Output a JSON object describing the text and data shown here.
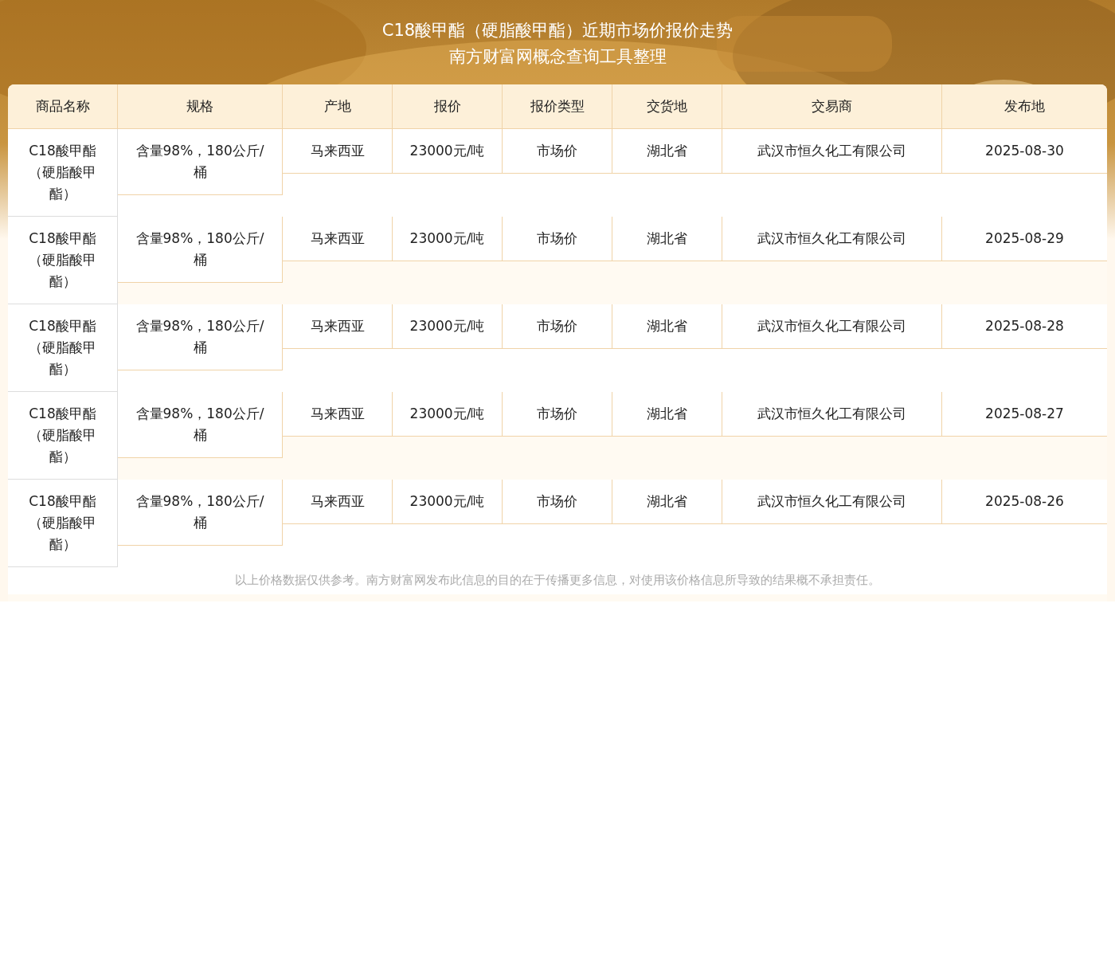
{
  "title": {
    "line_1": "C18酸甲酯（硬脂酸甲酯）近期市场价报价走势",
    "line_2": "南方财富网概念查询工具整理"
  },
  "table": {
    "columns": [
      "商品名称",
      "规格",
      "产地",
      "报价",
      "报价类型",
      "交货地",
      "交易商",
      "发布地"
    ],
    "rows": [
      [
        "C18酸甲酯（硬脂酸甲酯）",
        "含量98%，180公斤/桶",
        "马来西亚",
        "23000元/吨",
        "市场价",
        "湖北省",
        "武汉市恒久化工有限公司",
        "2025-08-30"
      ],
      [
        "C18酸甲酯（硬脂酸甲酯）",
        "含量98%，180公斤/桶",
        "马来西亚",
        "23000元/吨",
        "市场价",
        "湖北省",
        "武汉市恒久化工有限公司",
        "2025-08-29"
      ],
      [
        "C18酸甲酯（硬脂酸甲酯）",
        "含量98%，180公斤/桶",
        "马来西亚",
        "23000元/吨",
        "市场价",
        "湖北省",
        "武汉市恒久化工有限公司",
        "2025-08-28"
      ],
      [
        "C18酸甲酯（硬脂酸甲酯）",
        "含量98%，180公斤/桶",
        "马来西亚",
        "23000元/吨",
        "市场价",
        "湖北省",
        "武汉市恒久化工有限公司",
        "2025-08-27"
      ],
      [
        "C18酸甲酯（硬脂酸甲酯）",
        "含量98%，180公斤/桶",
        "马来西亚",
        "23000元/吨",
        "市场价",
        "湖北省",
        "武汉市恒久化工有限公司",
        "2025-08-26"
      ]
    ]
  },
  "disclaimer": "以上价格数据仅供参考。南方财富网发布此信息的目的在于传播更多信息，对使用该价格信息所导致的结果概不承担责任。"
}
